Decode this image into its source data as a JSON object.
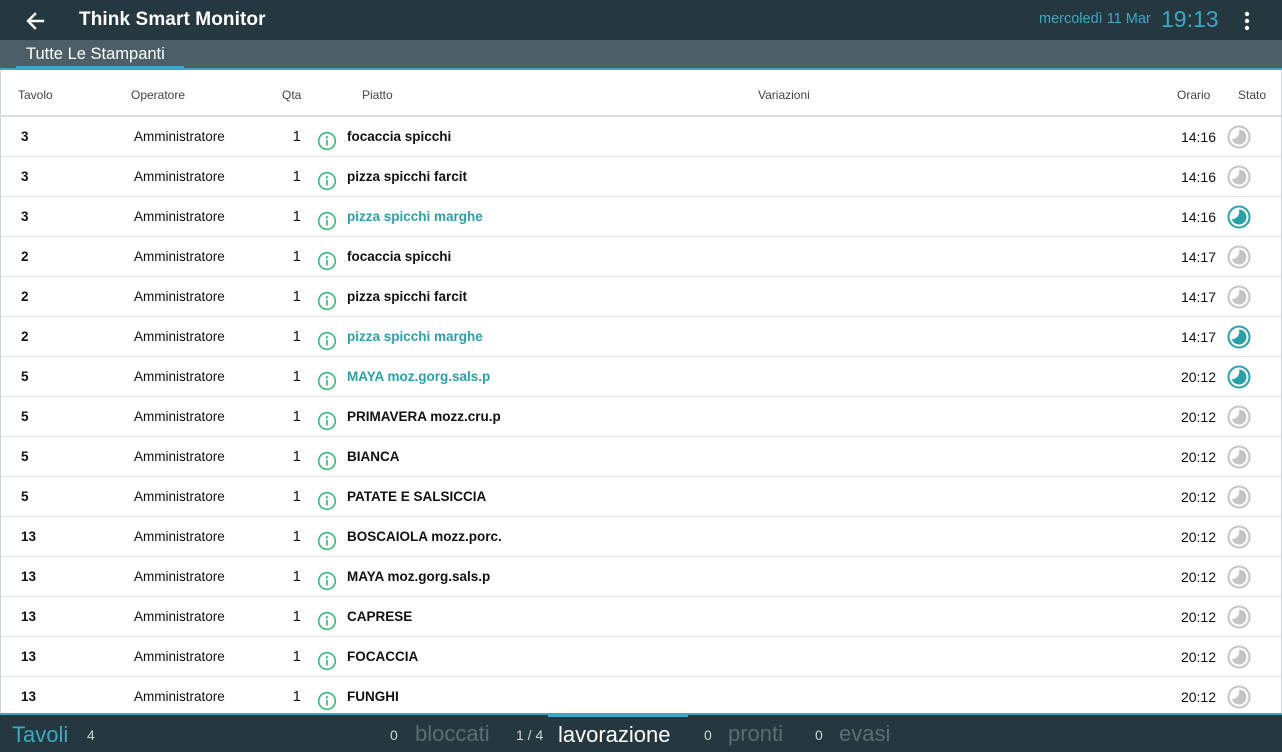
{
  "header": {
    "title": "Think Smart Monitor",
    "date": "mercoledì 11 Mar",
    "time": "19:13"
  },
  "tabs": [
    {
      "label": "Tutte Le Stampanti",
      "active": true
    }
  ],
  "table": {
    "columns": {
      "tavolo": "Tavolo",
      "operatore": "Operatore",
      "qta": "Qta",
      "piatto": "Piatto",
      "variazioni": "Variazioni",
      "orario": "Orario",
      "stato": "Stato"
    },
    "rows": [
      {
        "tavolo": "3",
        "operatore": "Amministratore",
        "qta": "1",
        "piatto": "focaccia spicchi",
        "variazioni": "",
        "orario": "14:16",
        "in_lavorazione": false
      },
      {
        "tavolo": "3",
        "operatore": "Amministratore",
        "qta": "1",
        "piatto": "pizza spicchi farcit",
        "variazioni": "",
        "orario": "14:16",
        "in_lavorazione": false
      },
      {
        "tavolo": "3",
        "operatore": "Amministratore",
        "qta": "1",
        "piatto": "pizza spicchi marghe",
        "variazioni": "",
        "orario": "14:16",
        "in_lavorazione": true
      },
      {
        "tavolo": "2",
        "operatore": "Amministratore",
        "qta": "1",
        "piatto": "focaccia spicchi",
        "variazioni": "",
        "orario": "14:17",
        "in_lavorazione": false
      },
      {
        "tavolo": "2",
        "operatore": "Amministratore",
        "qta": "1",
        "piatto": "pizza spicchi farcit",
        "variazioni": "",
        "orario": "14:17",
        "in_lavorazione": false
      },
      {
        "tavolo": "2",
        "operatore": "Amministratore",
        "qta": "1",
        "piatto": "pizza spicchi marghe",
        "variazioni": "",
        "orario": "14:17",
        "in_lavorazione": true
      },
      {
        "tavolo": "5",
        "operatore": "Amministratore",
        "qta": "1",
        "piatto": "MAYA moz.gorg.sals.p",
        "variazioni": "",
        "orario": "20:12",
        "in_lavorazione": true
      },
      {
        "tavolo": "5",
        "operatore": "Amministratore",
        "qta": "1",
        "piatto": "PRIMAVERA mozz.cru.p",
        "variazioni": "",
        "orario": "20:12",
        "in_lavorazione": false
      },
      {
        "tavolo": "5",
        "operatore": "Amministratore",
        "qta": "1",
        "piatto": "BIANCA",
        "variazioni": "",
        "orario": "20:12",
        "in_lavorazione": false
      },
      {
        "tavolo": "5",
        "operatore": "Amministratore",
        "qta": "1",
        "piatto": "PATATE E SALSICCIA",
        "variazioni": "",
        "orario": "20:12",
        "in_lavorazione": false
      },
      {
        "tavolo": "13",
        "operatore": "Amministratore",
        "qta": "1",
        "piatto": "BOSCAIOLA mozz.porc.",
        "variazioni": "",
        "orario": "20:12",
        "in_lavorazione": false
      },
      {
        "tavolo": "13",
        "operatore": "Amministratore",
        "qta": "1",
        "piatto": "MAYA moz.gorg.sals.p",
        "variazioni": "",
        "orario": "20:12",
        "in_lavorazione": false
      },
      {
        "tavolo": "13",
        "operatore": "Amministratore",
        "qta": "1",
        "piatto": "CAPRESE",
        "variazioni": "",
        "orario": "20:12",
        "in_lavorazione": false
      },
      {
        "tavolo": "13",
        "operatore": "Amministratore",
        "qta": "1",
        "piatto": "FOCACCIA",
        "variazioni": "",
        "orario": "20:12",
        "in_lavorazione": false
      },
      {
        "tavolo": "13",
        "operatore": "Amministratore",
        "qta": "1",
        "piatto": "FUNGHI",
        "variazioni": "",
        "orario": "20:12",
        "in_lavorazione": false
      }
    ]
  },
  "footer": {
    "tavoli_label": "Tavoli",
    "tavoli_count": "4",
    "bloccati_count": "0",
    "bloccati_label": "bloccati",
    "lavorazione_count": "1 / 4",
    "lavorazione_label": "lavorazione",
    "pronti_count": "0",
    "pronti_label": "pronti",
    "evasi_count": "0",
    "evasi_label": "evasi"
  },
  "colors": {
    "accent": "#3ba9c5",
    "active_item": "#2aa1a7",
    "info_icon": "#2bb673",
    "status_idle": "#c4c4c4",
    "appbar_bg": "#25373f"
  },
  "icons": {
    "back": "arrow-left-icon",
    "menu": "more-vert-icon",
    "info": "info-circle-icon",
    "status": "clock-status-icon"
  }
}
